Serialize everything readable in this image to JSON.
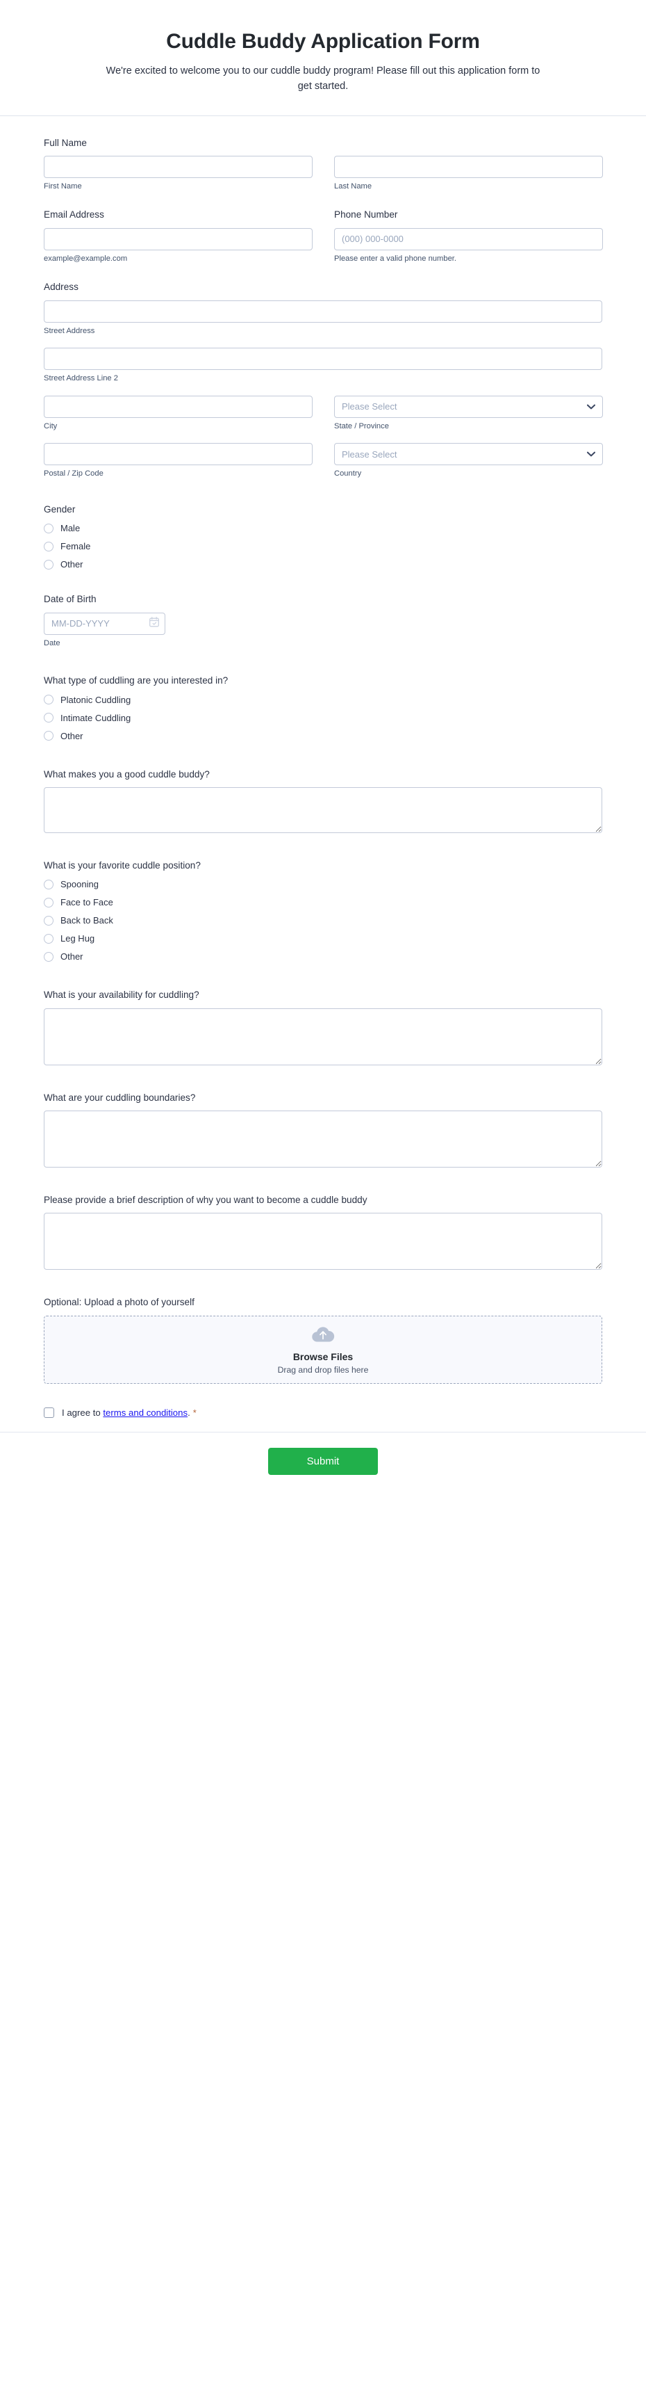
{
  "header": {
    "title": "Cuddle Buddy Application Form",
    "subtitle": "We're excited to welcome you to our cuddle buddy program! Please fill out this application form to get started."
  },
  "fields": {
    "full_name": {
      "label": "Full Name",
      "first": {
        "sub_label": "First Name",
        "value": "",
        "placeholder": ""
      },
      "last": {
        "sub_label": "Last Name",
        "value": "",
        "placeholder": ""
      }
    },
    "email": {
      "label": "Email Address",
      "sub_label": "example@example.com",
      "value": "",
      "placeholder": ""
    },
    "phone": {
      "label": "Phone Number",
      "sub_label": "Please enter a valid phone number.",
      "value": "",
      "placeholder": "(000) 000-0000"
    },
    "address": {
      "label": "Address",
      "street": {
        "sub_label": "Street Address",
        "value": "",
        "placeholder": ""
      },
      "street2": {
        "sub_label": "Street Address Line 2",
        "value": "",
        "placeholder": ""
      },
      "city": {
        "sub_label": "City",
        "value": "",
        "placeholder": ""
      },
      "state": {
        "sub_label": "State / Province",
        "selected": "Please Select"
      },
      "postal": {
        "sub_label": "Postal / Zip Code",
        "value": "",
        "placeholder": ""
      },
      "country": {
        "sub_label": "Country",
        "selected": "Please Select"
      }
    },
    "gender": {
      "label": "Gender",
      "options": [
        "Male",
        "Female",
        "Other"
      ]
    },
    "dob": {
      "label": "Date of Birth",
      "sub_label": "Date",
      "value": "",
      "placeholder": "MM-DD-YYYY"
    },
    "cuddle_type": {
      "label": "What type of cuddling are you interested in?",
      "options": [
        "Platonic Cuddling",
        "Intimate Cuddling",
        "Other"
      ]
    },
    "good_buddy": {
      "label": "What makes you a good cuddle buddy?",
      "value": ""
    },
    "position": {
      "label": "What is your favorite cuddle position?",
      "options": [
        "Spooning",
        "Face to Face",
        "Back to Back",
        "Leg Hug",
        "Other"
      ]
    },
    "availability": {
      "label": "What is your availability for cuddling?",
      "value": ""
    },
    "boundaries": {
      "label": "What are your cuddling boundaries?",
      "value": ""
    },
    "why": {
      "label": "Please provide a brief description of why you want to become a cuddle buddy",
      "value": ""
    },
    "upload": {
      "label": "Optional: Upload a photo of yourself",
      "browse_label": "Browse Files",
      "drag_label": "Drag and drop files here",
      "icon": "cloud-upload-icon"
    },
    "terms": {
      "prefix": "I agree to ",
      "link_text": "terms and conditions",
      "suffix": ".",
      "required_marker": "*"
    }
  },
  "footer": {
    "submit_label": "Submit"
  },
  "colors": {
    "submit_green": "#21b04b",
    "link_blue": "#1a15f0",
    "required_orange": "#b4653b",
    "border_grey": "#c3cad9"
  }
}
